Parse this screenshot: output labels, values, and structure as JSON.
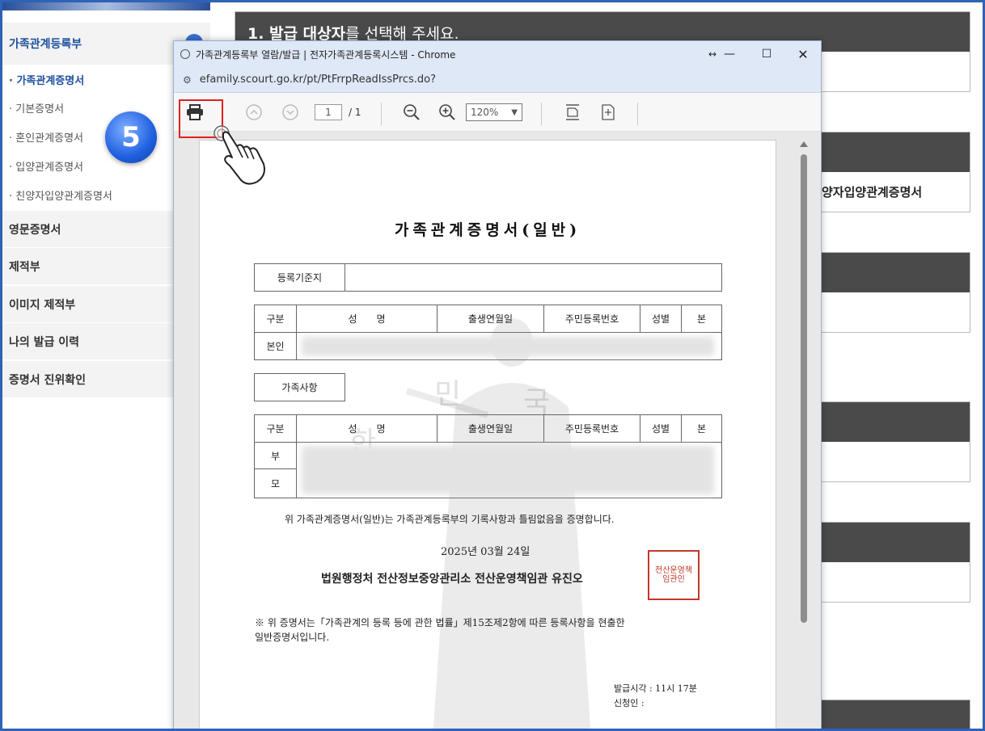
{
  "sidebar": {
    "header": "가족관계등록부",
    "badge": "⌄",
    "sub_items": [
      "· 가족관계증명서",
      "· 기본증명서",
      "· 혼인관계증명서",
      "· 입양관계증명서",
      "· 친양자입양관계증명서"
    ],
    "menu_items": [
      "영문증명서",
      "제적부",
      "이미지 제적부",
      "나의 발급 이력",
      "증명서 진위확인"
    ]
  },
  "step_badge": "5",
  "main": {
    "title_bold": "1. 발급 대상자",
    "title_rest": "를 선택해 주세요.",
    "panel_text": "양자입양관계증명서"
  },
  "popup": {
    "window_title": "가족관계등록부 열람/발급 | 전자가족관계등록시스템 - Chrome",
    "url": "efamily.scourt.go.kr/pt/PtFrrpReadIssPrcs.do?",
    "page_current": "1",
    "page_total": "/ 1",
    "zoom": "120%"
  },
  "document": {
    "title": "가족관계증명서(일반)",
    "registry_label": "등록기준지",
    "headers": [
      "구분",
      "성　　명",
      "출생연월일",
      "주민등록번호",
      "성별",
      "본"
    ],
    "self_label": "본인",
    "family_label": "가족사항",
    "father_label": "부",
    "mother_label": "모",
    "statement": "위 가족관계증명서(일반)는 가족관계등록부의 기록사항과 틀림없음을 증명합니다.",
    "date": "2025년 03월 24일",
    "issuer": "법원행정처 전산정보중앙관리소 전산운영책임관 유진오",
    "seal_text": "전산운영책임관인",
    "note_line1": "※ 위 증명서는「가족관계의 등록 등에 관한 법률」제15조제2항에 따른 등록사항을 현출한",
    "note_line2": "일반증명서입니다.",
    "issue_time": "발급시각 : 11시 17분",
    "applicant": "신청인 :",
    "watermark": [
      "민",
      "국",
      "한"
    ]
  },
  "colors": {
    "accent": "#1d4f9c",
    "highlight": "#e21f1f",
    "frame": "#2e63b6"
  }
}
